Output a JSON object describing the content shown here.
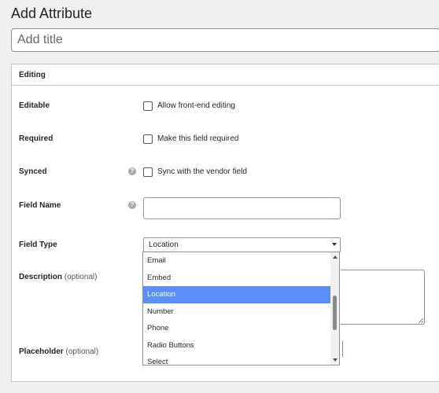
{
  "page": {
    "title": "Add Attribute"
  },
  "title_field": {
    "placeholder": "Add title",
    "value": ""
  },
  "section": {
    "heading": "Editing"
  },
  "fields": {
    "editable": {
      "label": "Editable",
      "checkbox_label": "Allow front-end editing",
      "checked": false
    },
    "required": {
      "label": "Required",
      "checkbox_label": "Make this field required",
      "checked": false
    },
    "synced": {
      "label": "Synced",
      "help_icon": "?",
      "checkbox_label": "Sync with the vendor field",
      "checked": false
    },
    "field_name": {
      "label": "Field Name",
      "help_icon": "?",
      "value": ""
    },
    "field_type": {
      "label": "Field Type",
      "selected": "Location"
    },
    "description": {
      "label": "Description",
      "optional": "(optional)"
    },
    "placeholder": {
      "label": "Placeholder",
      "optional": "(optional)"
    }
  },
  "dropdown": {
    "options": [
      "Email",
      "Embed",
      "Location",
      "Number",
      "Phone",
      "Radio Buttons",
      "Select"
    ],
    "selected_index": 2,
    "highlight_color": "#5a8ffa"
  },
  "colors": {
    "background": "#f0f0f1",
    "panel": "#ffffff",
    "border": "#c3c4c7"
  }
}
